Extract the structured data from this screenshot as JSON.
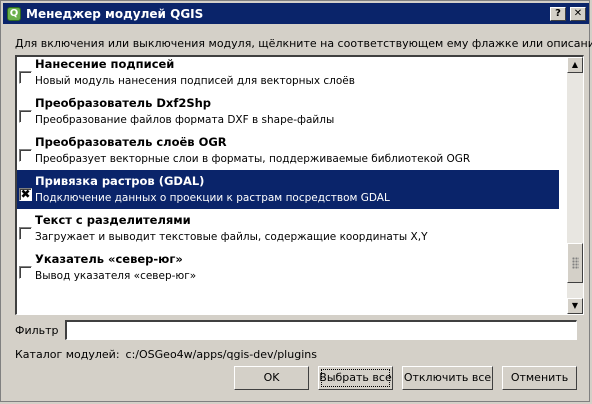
{
  "window": {
    "title": "Менеджер модулей QGIS",
    "help_label": "?",
    "close_label": "✕",
    "icon_label": "Q"
  },
  "instruction": "Для включения или выключения модуля, щёлкните на соответствующем ему флажке или описании",
  "plugins": [
    {
      "name": "Нанесение подписей",
      "description": "Новый модуль нанесения подписей для векторных слоёв",
      "checked": false,
      "selected": false
    },
    {
      "name": "Преобразователь Dxf2Shp",
      "description": "Преобразование файлов формата DXF в shape-файлы",
      "checked": false,
      "selected": false
    },
    {
      "name": "Преобразователь слоёв OGR",
      "description": "Преобразует векторные слои в форматы, поддерживаемые библиотекой OGR",
      "checked": false,
      "selected": false
    },
    {
      "name": "Привязка растров (GDAL)",
      "description": "Подключение данных о проекции к растрам посредством GDAL",
      "checked": true,
      "selected": true
    },
    {
      "name": "Текст с разделителями",
      "description": "Загружает и выводит текстовые файлы, содержащие координаты X,Y",
      "checked": false,
      "selected": false
    },
    {
      "name": "Указатель «север-юг»",
      "description": "Вывод указателя «север-юг»",
      "checked": false,
      "selected": false
    }
  ],
  "filter": {
    "label": "Фильтр",
    "value": ""
  },
  "catalog": {
    "label": "Каталог модулей:",
    "value": "c:/OSGeo4w/apps/qgis-dev/plugins"
  },
  "buttons": {
    "ok": "OK",
    "select_all": "Выбрать все",
    "deselect_all": "Отключить все",
    "cancel": "Отменить"
  },
  "colors": {
    "selection": "#0a246a",
    "titlebar": "#0a246a",
    "face": "#d4d0c8"
  }
}
